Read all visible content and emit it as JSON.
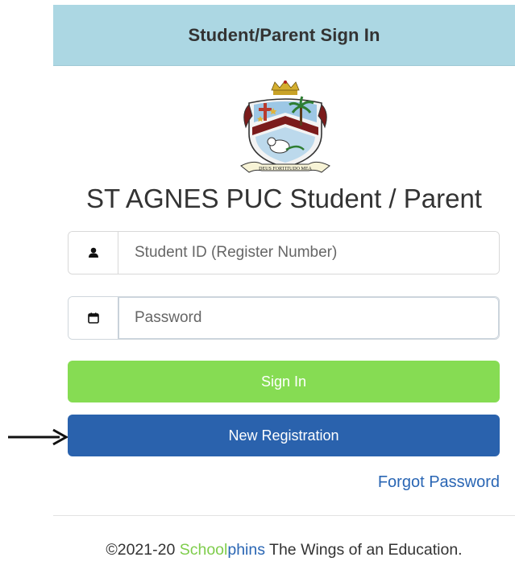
{
  "header": {
    "title": "Student/Parent Sign In"
  },
  "crest": {
    "motto": "DEUS FORTITUDO MEA"
  },
  "school_title": "ST AGNES PUC Student / Parent",
  "form": {
    "student_id": {
      "placeholder": "Student ID (Register Number)",
      "value": "",
      "icon": "user-icon"
    },
    "password": {
      "placeholder": "Password",
      "value": "",
      "icon": "calendar-icon"
    }
  },
  "buttons": {
    "signin_label": "Sign In",
    "register_label": "New Registration"
  },
  "links": {
    "forgot_password": "Forgot Password"
  },
  "footer": {
    "prefix": "©2021-20 ",
    "brand_part1": "School",
    "brand_part2": "phins",
    "suffix": " The Wings of an Education."
  },
  "colors": {
    "header_bg": "#acd7e3",
    "signin_bg": "#86dc53",
    "register_bg": "#2a62ad",
    "link": "#2a66b4",
    "brand_green": "#7fcd4c"
  }
}
